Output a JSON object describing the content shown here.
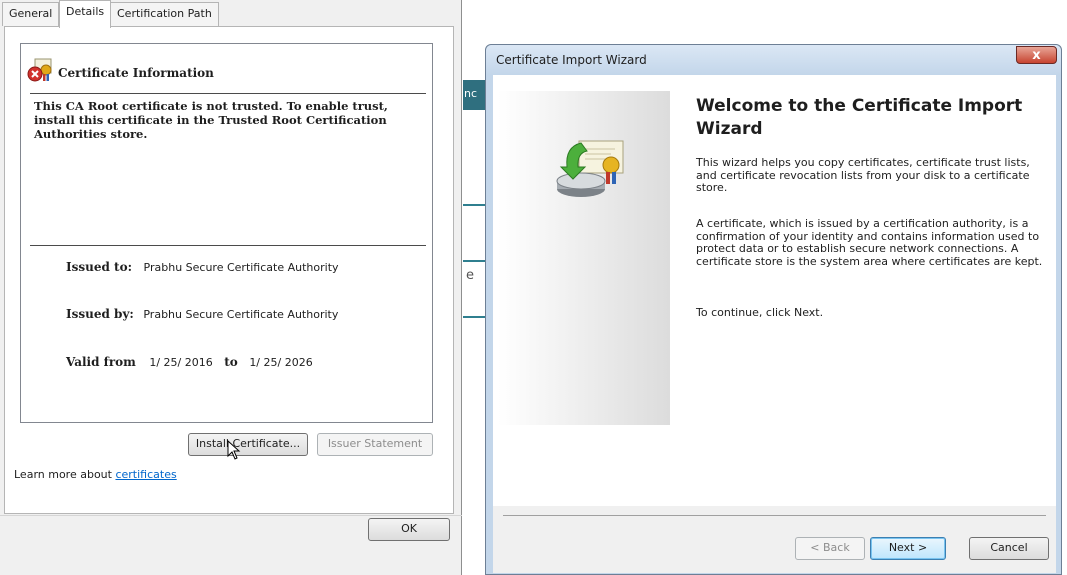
{
  "cert_dialog": {
    "tabs": [
      "General",
      "Details",
      "Certification Path"
    ],
    "info_title": "Certificate Information",
    "trust_message": "This CA Root certificate is not trusted. To enable trust, install this certificate in the Trusted Root Certification Authorities store.",
    "issued_to_label": "Issued to:",
    "issued_to_value": "Prabhu Secure Certificate Authority",
    "issued_by_label": "Issued by:",
    "issued_by_value": "Prabhu Secure Certificate Authority",
    "valid_from_label": "Valid from",
    "valid_from_value": "1/ 25/ 2016",
    "valid_to_label": "to",
    "valid_to_value": "1/ 25/ 2026",
    "install_button": "Install Certificate...",
    "issuer_statement_button": "Issuer Statement",
    "learn_more_prefix": "Learn more about ",
    "learn_more_link": "certificates",
    "ok_button": "OK"
  },
  "background": {
    "fragment_1": "nc",
    "fragment_2": "e"
  },
  "wizard": {
    "title": "Certificate Import Wizard",
    "close_glyph": "x",
    "heading": "Welcome to the Certificate Import Wizard",
    "paragraph_1": "This wizard helps you copy certificates, certificate trust lists, and certificate revocation lists from your disk to a certificate store.",
    "paragraph_2": "A certificate, which is issued by a certification authority, is a confirmation of your identity and contains information used to protect data or to establish secure network connections. A certificate store is the system area where certificates are kept.",
    "paragraph_3": "To continue, click Next.",
    "back_button": "< Back",
    "next_button": "Next >",
    "cancel_button": "Cancel"
  },
  "icons": {
    "cert_error_icon": "certificate-with-red-x",
    "wizard_icon": "certificate-import-drive",
    "cursor": "mouse-pointer"
  },
  "colors": {
    "link": "#0066cc",
    "wizard_frame": "#c3d6ea",
    "close_button": "#c74430",
    "background_teal": "#2f6f7f"
  }
}
